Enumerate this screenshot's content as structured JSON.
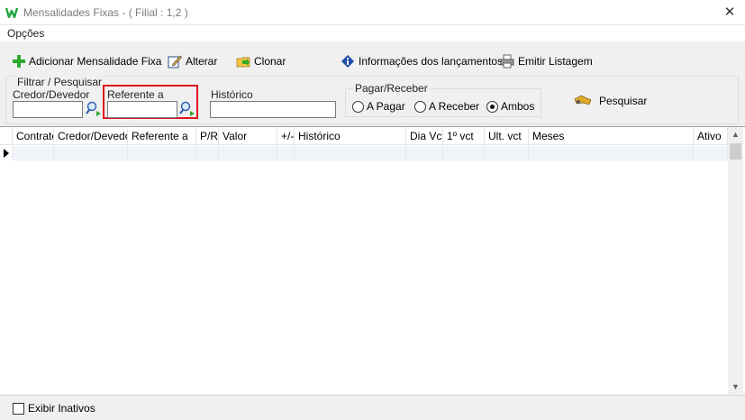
{
  "window": {
    "title": "Mensalidades Fixas - ( Filial : 1,2 )",
    "close_glyph": "✕",
    "brand_color": "#1fa53c"
  },
  "menu": {
    "items": [
      "Opções"
    ]
  },
  "toolbar": {
    "add_label": "Adicionar Mensalidade Fixa",
    "edit_label": "Alterar",
    "clone_label": "Clonar",
    "info_label": "Informações dos lançamentos",
    "print_label": "Emitir Listagem"
  },
  "filter": {
    "group_label": "Filtrar / Pesquisar",
    "credor_label": "Credor/Devedor",
    "credor_value": "",
    "referente_label": "Referente a",
    "referente_value": "",
    "historico_label": "Histórico",
    "historico_value": "",
    "highlight_color": "#e0141e"
  },
  "pagar_receber": {
    "label": "Pagar/Receber",
    "options": [
      "A Pagar",
      "A Receber",
      "Ambos"
    ],
    "selected": "Ambos"
  },
  "search_label": "Pesquisar",
  "grid": {
    "columns": [
      "Contrato",
      "Credor/Devedor",
      "Referente a",
      "P/R",
      "Valor",
      "+/-",
      "Histórico",
      "Dia Vct",
      "1º vct",
      "Ult. vct",
      "Meses",
      "Ativo"
    ],
    "rows": [
      [
        "",
        "",
        "",
        "",
        "",
        "",
        "",
        "",
        "",
        "",
        "",
        ""
      ]
    ]
  },
  "footer": {
    "show_inactive_label": "Exibir Inativos",
    "show_inactive_checked": false
  }
}
